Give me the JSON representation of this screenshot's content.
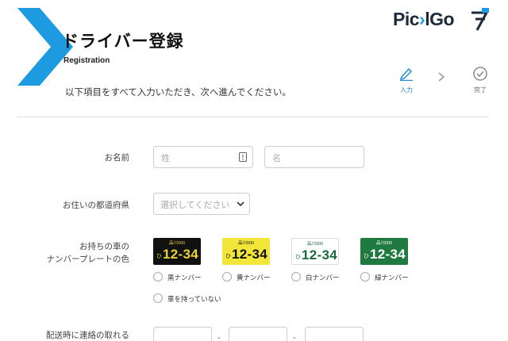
{
  "header": {
    "title": "ドライバー登録",
    "subtitle": "Registration",
    "intro": "以下項目をすべて入力いただき、次へ進んでください。"
  },
  "brand": {
    "logo_text": "PickGo",
    "accent_color": "#1e9ae0"
  },
  "steps": [
    {
      "label": "入力",
      "state": "active",
      "icon": "pencil-icon"
    },
    {
      "label": "完了",
      "state": "pending",
      "icon": "check-circle-icon"
    }
  ],
  "form": {
    "name": {
      "label": "お名前",
      "last_placeholder": "姓",
      "first_placeholder": "名"
    },
    "prefecture": {
      "label": "お住いの都道府県",
      "selected": "選択してください"
    },
    "plate": {
      "label_line1": "お持ちの車の",
      "label_line2": "ナンバープレートの色",
      "plates": [
        {
          "region": "品川000",
          "kana": "ひ",
          "number": "12-34",
          "color": "black"
        },
        {
          "region": "品川000",
          "kana": "ひ",
          "number": "12-34",
          "color": "yellow"
        },
        {
          "region": "品川000",
          "kana": "ひ",
          "number": "12-34",
          "color": "white"
        },
        {
          "region": "品川000",
          "kana": "ひ",
          "number": "12-34",
          "color": "green"
        }
      ],
      "options": [
        "黒ナンバー",
        "黄ナンバー",
        "白ナンバー",
        "緑ナンバー"
      ],
      "no_car": "車を持っていない"
    },
    "phone": {
      "label": "配送時に連絡の取れる",
      "separator": "-"
    }
  }
}
